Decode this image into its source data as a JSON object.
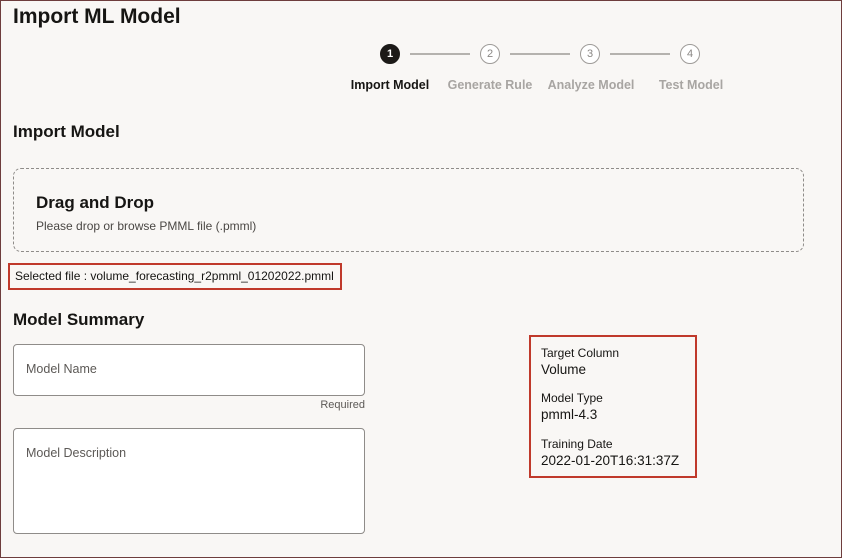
{
  "page": {
    "title": "Import ML Model"
  },
  "stepper": {
    "steps": [
      {
        "number": "1",
        "label": "Import Model",
        "state": "active"
      },
      {
        "number": "2",
        "label": "Generate Rule",
        "state": "inactive"
      },
      {
        "number": "3",
        "label": "Analyze Model",
        "state": "inactive"
      },
      {
        "number": "4",
        "label": "Test Model",
        "state": "inactive"
      }
    ]
  },
  "import_section": {
    "title": "Import Model",
    "dropzone": {
      "title": "Drag and Drop",
      "subtitle": "Please drop or browse PMML file (.pmml)"
    },
    "selected_file": "Selected file : volume_forecasting_r2pmml_01202022.pmml"
  },
  "summary": {
    "title": "Model Summary",
    "model_name": {
      "placeholder": "Model Name",
      "value": "",
      "hint": "Required"
    },
    "model_description": {
      "placeholder": "Model Description",
      "value": ""
    },
    "details": {
      "target_column_label": "Target Column",
      "target_column_value": "Volume",
      "model_type_label": "Model Type",
      "model_type_value": "pmml-4.3",
      "training_date_label": "Training Date",
      "training_date_value": "2022-01-20T16:31:37Z"
    }
  },
  "colors": {
    "highlight": "#c0392b",
    "active_step": "#1c1a18",
    "inactive_step_text": "#a8a5a2",
    "background": "#f9f7f5"
  }
}
